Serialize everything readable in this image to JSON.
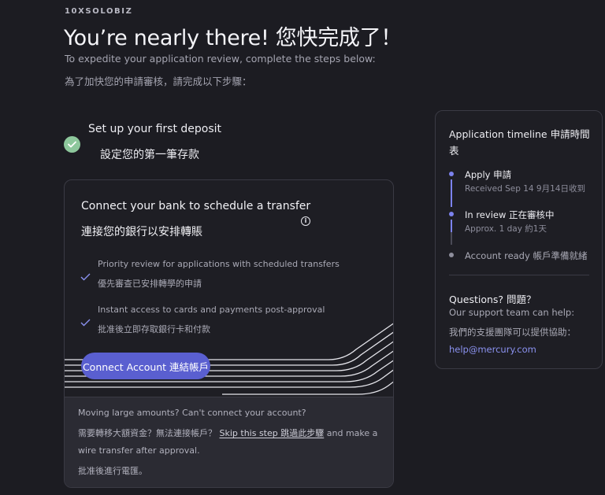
{
  "brand": "10XSOLOBIZ",
  "headline": "You’re nearly there!  您快完成了！",
  "intro": {
    "en": "To expedite your application review, complete the steps below:",
    "zh": "為了加快您的申請審核，請完成以下步驟："
  },
  "completed_step": {
    "en": "Set up your first deposit",
    "zh": "設定您的第一筆存款",
    "icon": "check-circle-icon",
    "color": "#8dc79c"
  },
  "card": {
    "title_en": "Connect your bank to schedule a transfer",
    "title_zh": "連接您的銀行以安排轉賬",
    "info_icon": "i",
    "benefits": [
      {
        "en": "Priority review for applications with scheduled transfers",
        "zh": "優先審查已安排轉學的申請"
      },
      {
        "en": "Instant access to cards and payments post-approval",
        "zh": "批准後立即存取銀行卡和付款"
      }
    ],
    "button_label": "Connect Account  連結帳戶",
    "accent": "#5a5fd0",
    "footer": {
      "line1": "Moving large amounts? Can't connect your account?",
      "line2_pre": "需要轉移大額資金？無法連接帳戶？ ",
      "skip_link": "Skip this step  跳過此步驟",
      "line2_post": " and make a",
      "line3": "wire transfer after approval.",
      "line4": "批准後進行電匯。"
    }
  },
  "timeline": {
    "title_line1": "Application timeline  申請時間",
    "title_line2": "表",
    "items": [
      {
        "label": "Apply  申請",
        "sub": "Received Sep 14  9月14日收到",
        "status": "done"
      },
      {
        "label": "In review  正在審核中",
        "sub": "Approx. 1 day  約1天",
        "status": "current"
      },
      {
        "label": "Account ready  帳戶準備就緒",
        "sub": "",
        "status": "pending"
      }
    ],
    "accent": "#7c82ee"
  },
  "questions": {
    "title": "Questions?  問題？",
    "en": "Our support team can help:",
    "zh": "我們的支援團隊可以提供協助：",
    "email": "help@mercury.com"
  }
}
